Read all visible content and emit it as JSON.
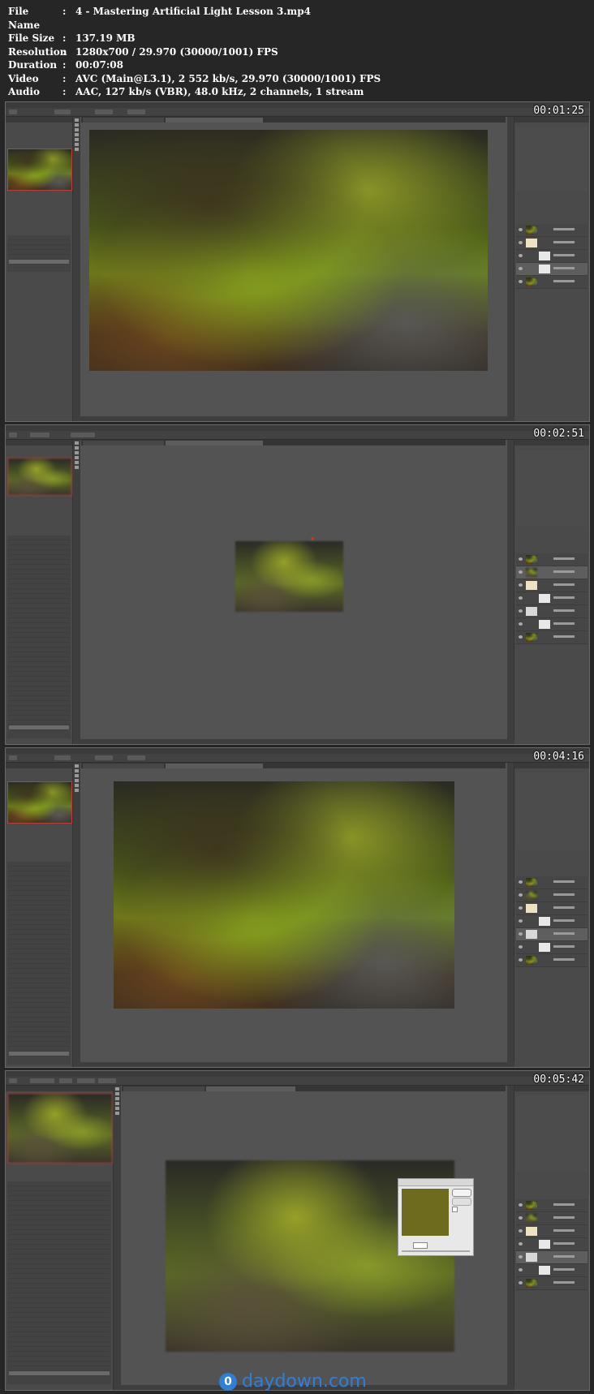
{
  "info": {
    "rows": [
      {
        "key": "File Name",
        "value": "4 - Mastering Artificial Light Lesson 3.mp4"
      },
      {
        "key": "File Size",
        "value": "137.19 MB"
      },
      {
        "key": "Resolution",
        "value": "1280x700 / 29.970 (30000/1001) FPS"
      },
      {
        "key": "Duration",
        "value": "00:07:08"
      },
      {
        "key": "Video",
        "value": "AVC (Main@L3.1), 2 552 kb/s, 29.970 (30000/1001) FPS"
      },
      {
        "key": "Audio",
        "value": "AAC, 127 kb/s (VBR), 48.0 kHz, 2 channels, 1 stream"
      }
    ],
    "separator": ":"
  },
  "frames": [
    {
      "timestamp": "00:01:25"
    },
    {
      "timestamp": "00:02:51"
    },
    {
      "timestamp": "00:04:16"
    },
    {
      "timestamp": "00:05:42"
    }
  ],
  "watermark": {
    "icon_char": "0",
    "text": "daydown.com",
    "color": "#2f7fd8"
  },
  "colors": {
    "accent_selection": "#b8423a",
    "panel": "#4a4a4a",
    "workspace": "#535353"
  }
}
